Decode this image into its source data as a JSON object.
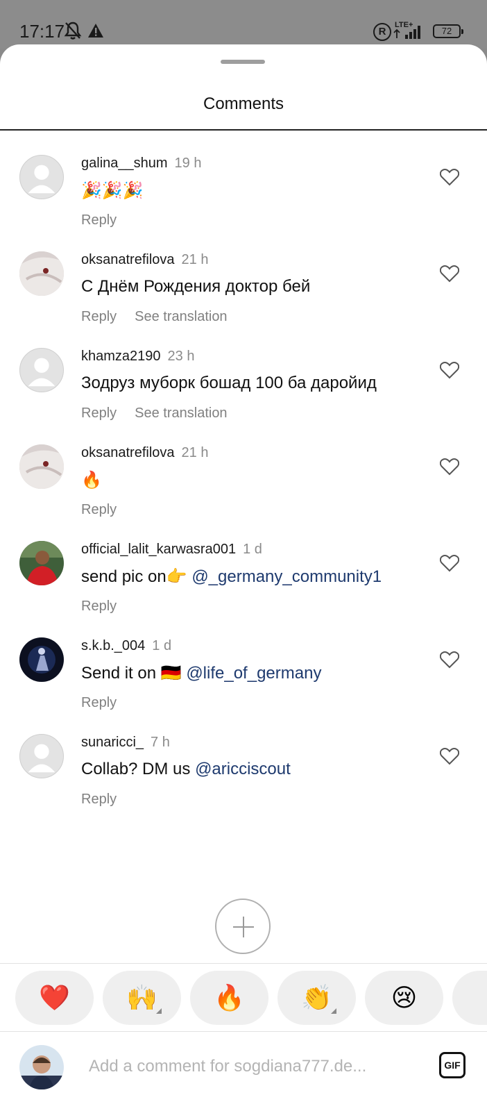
{
  "status_bar": {
    "time": "17:17",
    "network": "LTE+",
    "battery": "72",
    "icons": [
      "bell-off-icon",
      "warning-icon",
      "registered-icon",
      "signal-icon",
      "battery-icon"
    ]
  },
  "sheet": {
    "title": "Comments"
  },
  "comments": [
    {
      "username": "galina__shum",
      "time": "19 h",
      "text": "🎉🎉🎉",
      "mention": "",
      "actions": [
        "Reply"
      ],
      "avatar": "default"
    },
    {
      "username": "oksanatrefilova",
      "time": "21 h",
      "text": "С Днём Рождения  доктор бей",
      "mention": "",
      "actions": [
        "Reply",
        "See translation"
      ],
      "avatar": "photo"
    },
    {
      "username": "khamza2190",
      "time": "23 h",
      "text": "Зодруз муборк бошад 100 ба даройид",
      "mention": "",
      "actions": [
        "Reply",
        "See translation"
      ],
      "avatar": "default"
    },
    {
      "username": "oksanatrefilova",
      "time": "21 h",
      "text": "🔥",
      "mention": "",
      "actions": [
        "Reply"
      ],
      "avatar": "photo"
    },
    {
      "username": "official_lalit_karwasra001",
      "time": "1 d",
      "text": "send pic on👉 ",
      "mention": "@_germany_community1",
      "actions": [
        "Reply"
      ],
      "avatar": "photo"
    },
    {
      "username": "s.k.b._004",
      "time": "1 d",
      "text": "Send it on 🇩🇪 ",
      "mention": "@life_of_germany",
      "actions": [
        "Reply"
      ],
      "avatar": "photo"
    },
    {
      "username": "sunaricci_",
      "time": "7 h",
      "text": "Collab? DM us ",
      "mention": "@aricciscout",
      "actions": [
        "Reply"
      ],
      "avatar": "default"
    }
  ],
  "reactions": [
    {
      "emoji": "❤️",
      "has_variants": false
    },
    {
      "emoji": "🙌",
      "has_variants": true
    },
    {
      "emoji": "🔥",
      "has_variants": false
    },
    {
      "emoji": "👏",
      "has_variants": true
    },
    {
      "emoji": "😢",
      "has_variants": false
    },
    {
      "emoji": "",
      "has_variants": false
    }
  ],
  "composer": {
    "placeholder": "Add a comment for sogdiana777.de...",
    "gif_label": "GIF"
  },
  "nav": [
    "recents-button",
    "home-button",
    "back-button"
  ]
}
